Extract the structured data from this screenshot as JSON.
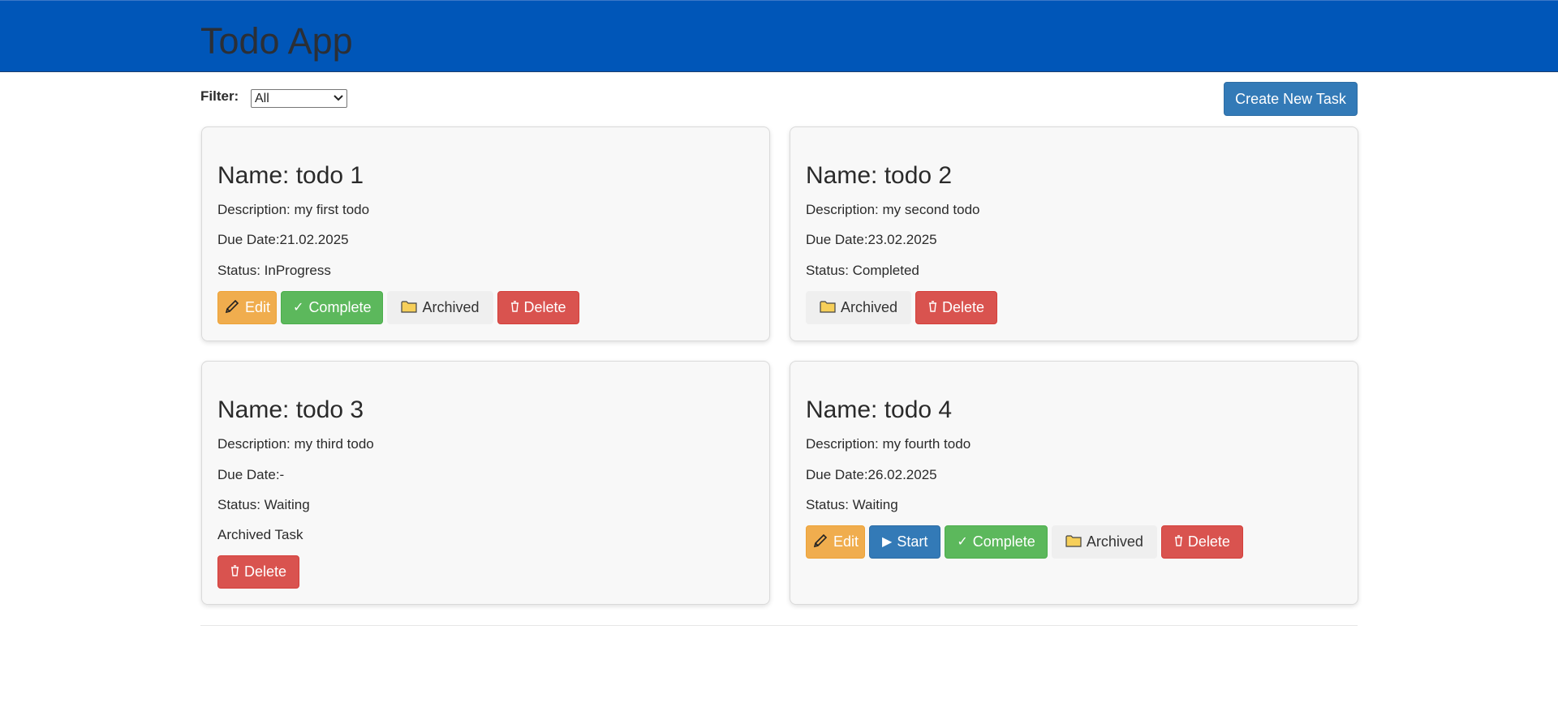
{
  "header": {
    "title": "Todo App",
    "bg_color": "#0056b8"
  },
  "filter": {
    "label": "Filter:",
    "selected": "All"
  },
  "create_button": {
    "label": "Create New Task"
  },
  "labels": {
    "edit": "Edit",
    "complete": "Complete",
    "archived": "Archived",
    "delete": "Delete",
    "start": "Start"
  },
  "todos": [
    {
      "name": "Name: todo 1",
      "description": "Description: my first todo",
      "due": "Due Date:21.02.2025",
      "status": "Status: InProgress",
      "note": ""
    },
    {
      "name": "Name: todo 2",
      "description": "Description: my second todo",
      "due": "Due Date:23.02.2025",
      "status": "Status: Completed",
      "note": ""
    },
    {
      "name": "Name: todo 3",
      "description": "Description: my third todo",
      "due": "Due Date:-",
      "status": "Status: Waiting",
      "note": "Archived Task"
    },
    {
      "name": "Name: todo 4",
      "description": "Description: my fourth todo",
      "due": "Due Date:26.02.2025",
      "status": "Status: Waiting",
      "note": ""
    }
  ]
}
